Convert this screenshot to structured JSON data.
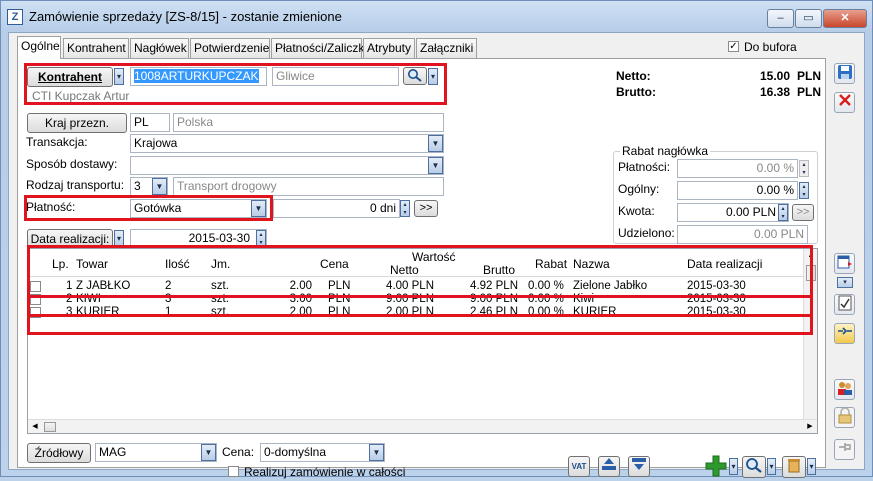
{
  "window": {
    "title": "Zamówienie sprzedaży [ZS-8/15] - zostanie zmienione",
    "controls": {
      "minimize": "–",
      "maximize": "▭",
      "close": "✕"
    }
  },
  "tabs": [
    "Ogólne",
    "Kontrahent",
    "Nagłówek",
    "Potwierdzenie",
    "Płatności/Zaliczki",
    "Atrybuty",
    "Załączniki"
  ],
  "do_bufora": {
    "label": "Do bufora",
    "checked": true
  },
  "kontrahent": {
    "button": "Kontrahent",
    "code": "1008ARTURKUPCZAK",
    "city": "Gliwice",
    "name": "CTI Kupczak Artur"
  },
  "kraj": {
    "button": "Kraj przezn.",
    "code": "PL",
    "name": "Polska"
  },
  "transakcja": {
    "label": "Transakcja:",
    "value": "Krajowa"
  },
  "sposob_dostawy": {
    "label": "Sposób dostawy:",
    "value": ""
  },
  "rodzaj_transportu": {
    "label": "Rodzaj transportu:",
    "code": "3",
    "value": "Transport drogowy"
  },
  "platnosc": {
    "label": "Płatność:",
    "value": "Gotówka",
    "days": "0 dni",
    "more": ">>"
  },
  "data_realizacji": {
    "button": "Data realizacji:",
    "value": "2015-03-30"
  },
  "totals": {
    "netto_label": "Netto:",
    "netto_value": "15.00",
    "netto_currency": "PLN",
    "brutto_label": "Brutto:",
    "brutto_value": "16.38",
    "brutto_currency": "PLN"
  },
  "rabat": {
    "title": "Rabat nagłówka",
    "platnosci_label": "Płatności:",
    "platnosci_value": "0.00 %",
    "ogolny_label": "Ogólny:",
    "ogolny_value": "0.00 %",
    "kwota_label": "Kwota:",
    "kwota_value": "0.00 PLN",
    "kwota_more": ">>",
    "udzielono_label": "Udzielono:",
    "udzielono_value": "0.00 PLN"
  },
  "table": {
    "headers": {
      "lp": "Lp.",
      "towar": "Towar",
      "ilosc": "Ilość",
      "jm": "Jm.",
      "cena": "Cena",
      "wartosc": "Wartość",
      "netto": "Netto",
      "brutto": "Brutto",
      "rabat": "Rabat",
      "nazwa": "Nazwa",
      "data": "Data realizacji"
    },
    "rows": [
      {
        "lp": "1",
        "towar": "Z JABŁKO",
        "ilosc": "2",
        "jm": "szt.",
        "cena": "2.00",
        "cena_cur": "PLN",
        "netto": "4.00 PLN",
        "brutto": "4.92 PLN",
        "rabat": "0.00 %",
        "nazwa": "Zielone Jabłko",
        "data": "2015-03-30"
      },
      {
        "lp": "2",
        "towar": "KIWI",
        "ilosc": "3",
        "jm": "szt.",
        "cena": "3.00",
        "cena_cur": "PLN",
        "netto": "9.00 PLN",
        "brutto": "9.00 PLN",
        "rabat": "0.00 %",
        "nazwa": "Kiwi",
        "data": "2015-03-30"
      },
      {
        "lp": "3",
        "towar": "KURIER",
        "ilosc": "1",
        "jm": "szt.",
        "cena": "2.00",
        "cena_cur": "PLN",
        "netto": "2.00 PLN",
        "brutto": "2.46 PLN",
        "rabat": "0.00 %",
        "nazwa": "KURIER",
        "data": "2015-03-30"
      }
    ]
  },
  "bottom": {
    "zrodlowy_button": "Źródłowy",
    "magazyn": "MAG",
    "cena_label": "Cena:",
    "cena_value": "0-domyślna",
    "realizuj_label": "Realizuj zamówienie w całości",
    "vat_label": "VAT"
  },
  "icons": {
    "save": "save-icon",
    "cancel": "cancel-icon",
    "search": "search-icon",
    "add": "add-icon",
    "trash": "trash-icon"
  },
  "colors": {
    "highlight": "#e0141e",
    "selection": "#3399ff",
    "add_green": "#2e9a2e",
    "cancel_red": "#d42020"
  }
}
